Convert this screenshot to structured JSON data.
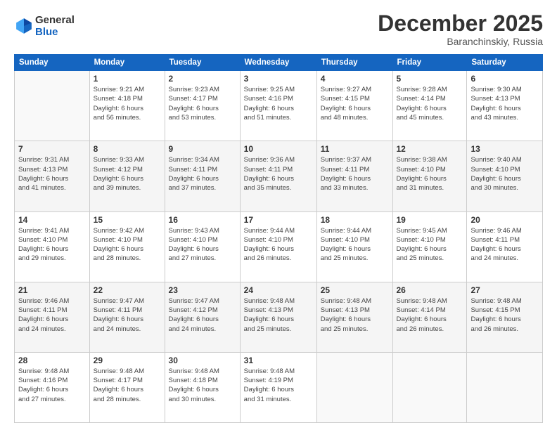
{
  "header": {
    "logo_line1": "General",
    "logo_line2": "Blue",
    "month": "December 2025",
    "location": "Baranchinskiy, Russia"
  },
  "weekdays": [
    "Sunday",
    "Monday",
    "Tuesday",
    "Wednesday",
    "Thursday",
    "Friday",
    "Saturday"
  ],
  "weeks": [
    [
      {
        "day": "",
        "info": ""
      },
      {
        "day": "1",
        "info": "Sunrise: 9:21 AM\nSunset: 4:18 PM\nDaylight: 6 hours\nand 56 minutes."
      },
      {
        "day": "2",
        "info": "Sunrise: 9:23 AM\nSunset: 4:17 PM\nDaylight: 6 hours\nand 53 minutes."
      },
      {
        "day": "3",
        "info": "Sunrise: 9:25 AM\nSunset: 4:16 PM\nDaylight: 6 hours\nand 51 minutes."
      },
      {
        "day": "4",
        "info": "Sunrise: 9:27 AM\nSunset: 4:15 PM\nDaylight: 6 hours\nand 48 minutes."
      },
      {
        "day": "5",
        "info": "Sunrise: 9:28 AM\nSunset: 4:14 PM\nDaylight: 6 hours\nand 45 minutes."
      },
      {
        "day": "6",
        "info": "Sunrise: 9:30 AM\nSunset: 4:13 PM\nDaylight: 6 hours\nand 43 minutes."
      }
    ],
    [
      {
        "day": "7",
        "info": "Sunrise: 9:31 AM\nSunset: 4:13 PM\nDaylight: 6 hours\nand 41 minutes."
      },
      {
        "day": "8",
        "info": "Sunrise: 9:33 AM\nSunset: 4:12 PM\nDaylight: 6 hours\nand 39 minutes."
      },
      {
        "day": "9",
        "info": "Sunrise: 9:34 AM\nSunset: 4:11 PM\nDaylight: 6 hours\nand 37 minutes."
      },
      {
        "day": "10",
        "info": "Sunrise: 9:36 AM\nSunset: 4:11 PM\nDaylight: 6 hours\nand 35 minutes."
      },
      {
        "day": "11",
        "info": "Sunrise: 9:37 AM\nSunset: 4:11 PM\nDaylight: 6 hours\nand 33 minutes."
      },
      {
        "day": "12",
        "info": "Sunrise: 9:38 AM\nSunset: 4:10 PM\nDaylight: 6 hours\nand 31 minutes."
      },
      {
        "day": "13",
        "info": "Sunrise: 9:40 AM\nSunset: 4:10 PM\nDaylight: 6 hours\nand 30 minutes."
      }
    ],
    [
      {
        "day": "14",
        "info": "Sunrise: 9:41 AM\nSunset: 4:10 PM\nDaylight: 6 hours\nand 29 minutes."
      },
      {
        "day": "15",
        "info": "Sunrise: 9:42 AM\nSunset: 4:10 PM\nDaylight: 6 hours\nand 28 minutes."
      },
      {
        "day": "16",
        "info": "Sunrise: 9:43 AM\nSunset: 4:10 PM\nDaylight: 6 hours\nand 27 minutes."
      },
      {
        "day": "17",
        "info": "Sunrise: 9:44 AM\nSunset: 4:10 PM\nDaylight: 6 hours\nand 26 minutes."
      },
      {
        "day": "18",
        "info": "Sunrise: 9:44 AM\nSunset: 4:10 PM\nDaylight: 6 hours\nand 25 minutes."
      },
      {
        "day": "19",
        "info": "Sunrise: 9:45 AM\nSunset: 4:10 PM\nDaylight: 6 hours\nand 25 minutes."
      },
      {
        "day": "20",
        "info": "Sunrise: 9:46 AM\nSunset: 4:11 PM\nDaylight: 6 hours\nand 24 minutes."
      }
    ],
    [
      {
        "day": "21",
        "info": "Sunrise: 9:46 AM\nSunset: 4:11 PM\nDaylight: 6 hours\nand 24 minutes."
      },
      {
        "day": "22",
        "info": "Sunrise: 9:47 AM\nSunset: 4:11 PM\nDaylight: 6 hours\nand 24 minutes."
      },
      {
        "day": "23",
        "info": "Sunrise: 9:47 AM\nSunset: 4:12 PM\nDaylight: 6 hours\nand 24 minutes."
      },
      {
        "day": "24",
        "info": "Sunrise: 9:48 AM\nSunset: 4:13 PM\nDaylight: 6 hours\nand 25 minutes."
      },
      {
        "day": "25",
        "info": "Sunrise: 9:48 AM\nSunset: 4:13 PM\nDaylight: 6 hours\nand 25 minutes."
      },
      {
        "day": "26",
        "info": "Sunrise: 9:48 AM\nSunset: 4:14 PM\nDaylight: 6 hours\nand 26 minutes."
      },
      {
        "day": "27",
        "info": "Sunrise: 9:48 AM\nSunset: 4:15 PM\nDaylight: 6 hours\nand 26 minutes."
      }
    ],
    [
      {
        "day": "28",
        "info": "Sunrise: 9:48 AM\nSunset: 4:16 PM\nDaylight: 6 hours\nand 27 minutes."
      },
      {
        "day": "29",
        "info": "Sunrise: 9:48 AM\nSunset: 4:17 PM\nDaylight: 6 hours\nand 28 minutes."
      },
      {
        "day": "30",
        "info": "Sunrise: 9:48 AM\nSunset: 4:18 PM\nDaylight: 6 hours\nand 30 minutes."
      },
      {
        "day": "31",
        "info": "Sunrise: 9:48 AM\nSunset: 4:19 PM\nDaylight: 6 hours\nand 31 minutes."
      },
      {
        "day": "",
        "info": ""
      },
      {
        "day": "",
        "info": ""
      },
      {
        "day": "",
        "info": ""
      }
    ]
  ]
}
